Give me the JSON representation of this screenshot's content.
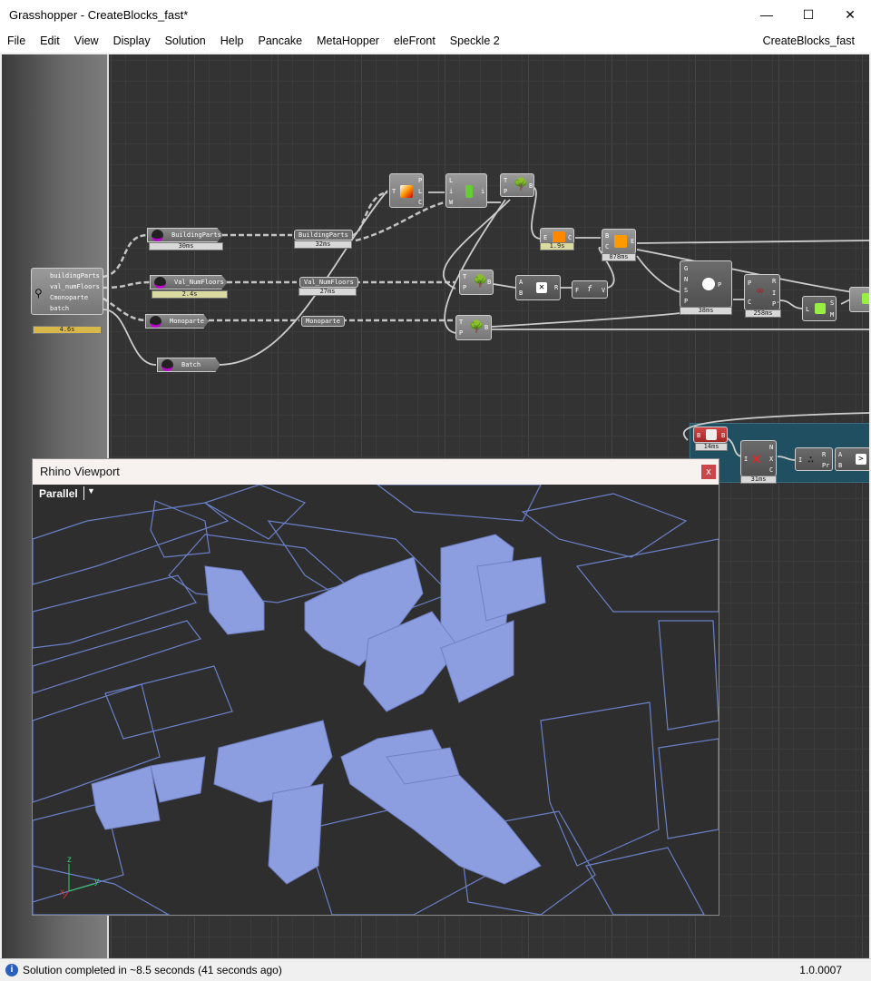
{
  "window": {
    "title": "Grasshopper - CreateBlocks_fast*",
    "document": "CreateBlocks_fast"
  },
  "menu": [
    "File",
    "Edit",
    "View",
    "Display",
    "Solution",
    "Help",
    "Pancake",
    "MetaHopper",
    "eleFront",
    "Speckle 2"
  ],
  "cluster": {
    "outputs": [
      "buildingParts",
      "val_numFloors",
      "Cmonoparte",
      "batch"
    ],
    "time": "4.6s"
  },
  "params": [
    {
      "label": "BuildingParts",
      "time": "30ms"
    },
    {
      "label": "Val_NumFloors",
      "time": "2.4s"
    },
    {
      "label": "Monoparte"
    },
    {
      "label": "Batch"
    }
  ],
  "relays": [
    {
      "label": "BuildingParts",
      "time": "32ms"
    },
    {
      "label": "Val_NumFloors",
      "time": "27ms"
    },
    {
      "label": "Monoparte"
    }
  ],
  "components": {
    "c1": {
      "in": [
        "T"
      ],
      "out": [
        "P",
        "L",
        "C"
      ]
    },
    "c2": {
      "in": [
        "L",
        "i",
        "W"
      ],
      "out": [
        "i"
      ]
    },
    "tree1": {
      "in": [
        "T",
        "P"
      ],
      "out": [
        "B"
      ]
    },
    "tree2": {
      "in": [
        "T",
        "P"
      ],
      "out": [
        "B"
      ]
    },
    "tree3": {
      "in": [
        "T",
        "P"
      ],
      "out": [
        "B"
      ]
    },
    "explode": {
      "in": [
        "E"
      ],
      "out": [
        "C"
      ],
      "time": "1.9s"
    },
    "boundary": {
      "in": [
        "B",
        "C"
      ],
      "out": [
        "E"
      ],
      "time": "878ms"
    },
    "mult": {
      "in": [
        "A",
        "B"
      ],
      "out": [
        "R"
      ]
    },
    "expr": {
      "in": [
        "F"
      ],
      "out": [
        "V"
      ]
    },
    "big": {
      "in": [
        "G",
        "N",
        "S",
        "P"
      ],
      "out": [
        "P"
      ],
      "time": "38ms"
    },
    "circ": {
      "in": [
        "P",
        "C"
      ],
      "out": [
        "R",
        "I",
        "P'"
      ],
      "time": "258ms"
    },
    "list": {
      "in": [
        "L"
      ],
      "out": [
        "S",
        "M"
      ]
    },
    "redc": {
      "in": [
        "B"
      ],
      "out": [
        "B"
      ],
      "time": "14ms"
    },
    "cross": {
      "in": [
        "I"
      ],
      "out": [
        "N",
        "X",
        "C"
      ],
      "time": "31ms"
    },
    "rand": {
      "in": [
        "I"
      ],
      "out": [
        "R",
        "Pr"
      ]
    },
    "cmp": {
      "in": [
        "A",
        "B"
      ]
    }
  },
  "viewport": {
    "title": "Rhino Viewport",
    "close": "x",
    "mode": "Parallel",
    "dropdown": "▼",
    "axes": [
      "z",
      "y",
      "x"
    ]
  },
  "colors": {
    "canvas": "#333333",
    "building": "#8c9de0",
    "outline": "#6a80c8",
    "group": "#1f4f60"
  },
  "status": {
    "message": "Solution completed in ~8.5 seconds (41 seconds ago)",
    "version": "1.0.0007"
  }
}
